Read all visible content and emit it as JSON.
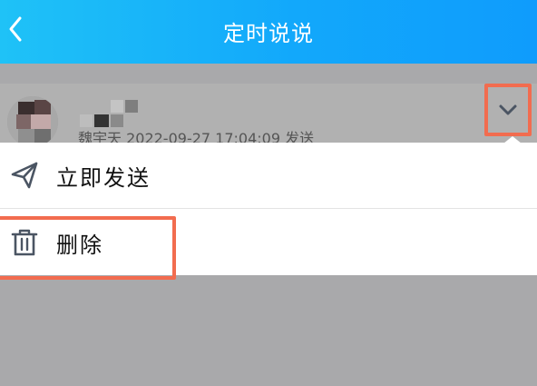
{
  "header": {
    "title": "定时说说",
    "back_icon": "chevron-left-icon",
    "background_colors": [
      "#1fc2f7",
      "#0f9cfc"
    ]
  },
  "post": {
    "meta_text": "魏宇天 2022-09-27 17:04:09 发送",
    "expand_icon": "chevron-down-icon"
  },
  "menu": {
    "items": [
      {
        "label": "立即发送",
        "icon": "send-icon"
      },
      {
        "label": "删除",
        "icon": "trash-icon"
      }
    ]
  },
  "colors": {
    "highlight": "#f26c4f",
    "overlay": "#a9a9ab",
    "icon": "#4b5563"
  }
}
